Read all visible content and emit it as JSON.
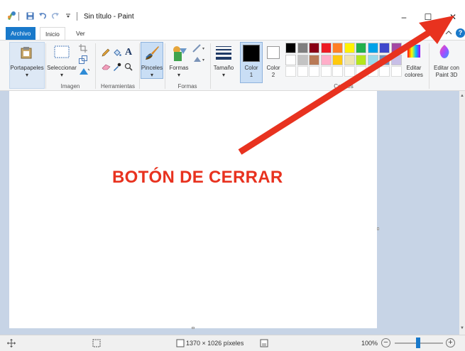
{
  "window": {
    "title": "Sin título - Paint",
    "controls": {
      "minimize": "–",
      "maximize": "☐",
      "close": "✕"
    }
  },
  "tabs": [
    {
      "label": "Archivo"
    },
    {
      "label": "Inicio"
    },
    {
      "label": "Ver"
    }
  ],
  "ribbon": {
    "groups": {
      "clipboard": {
        "button": "Portapapeles"
      },
      "image": {
        "label": "Imagen",
        "select": "Seleccionar"
      },
      "tools": {
        "label": "Herramientas"
      },
      "brushes": {
        "button": "Pinceles"
      },
      "shapes": {
        "label": "Formas",
        "button": "Formas"
      },
      "size": {
        "button": "Tamaño"
      },
      "color1": {
        "line1": "Color",
        "line2": "1"
      },
      "color2": {
        "line1": "Color",
        "line2": "2"
      },
      "colors": {
        "label": "Colores"
      },
      "edit_colors": {
        "line1": "Editar",
        "line2": "colores"
      },
      "paint3d": {
        "line1": "Editar con",
        "line2": "Paint 3D"
      }
    },
    "palette_row1": [
      "#000000",
      "#7f7f7f",
      "#880015",
      "#ed1c24",
      "#ff7f27",
      "#fff200",
      "#22b14c",
      "#00a2e8",
      "#3f48cc",
      "#a349a4"
    ],
    "palette_row2": [
      "#ffffff",
      "#c3c3c3",
      "#b97a57",
      "#ffaec9",
      "#ffc90e",
      "#efe4b0",
      "#b5e61d",
      "#99d9ea",
      "#7092be",
      "#c8bfe7"
    ]
  },
  "annotation": {
    "text": "BOTÓN DE CERRAR",
    "color": "#e8321f"
  },
  "statusbar": {
    "dimensions": "1370 × 1026 píxeles",
    "zoom": "100%",
    "zoom_level": 1.0
  }
}
